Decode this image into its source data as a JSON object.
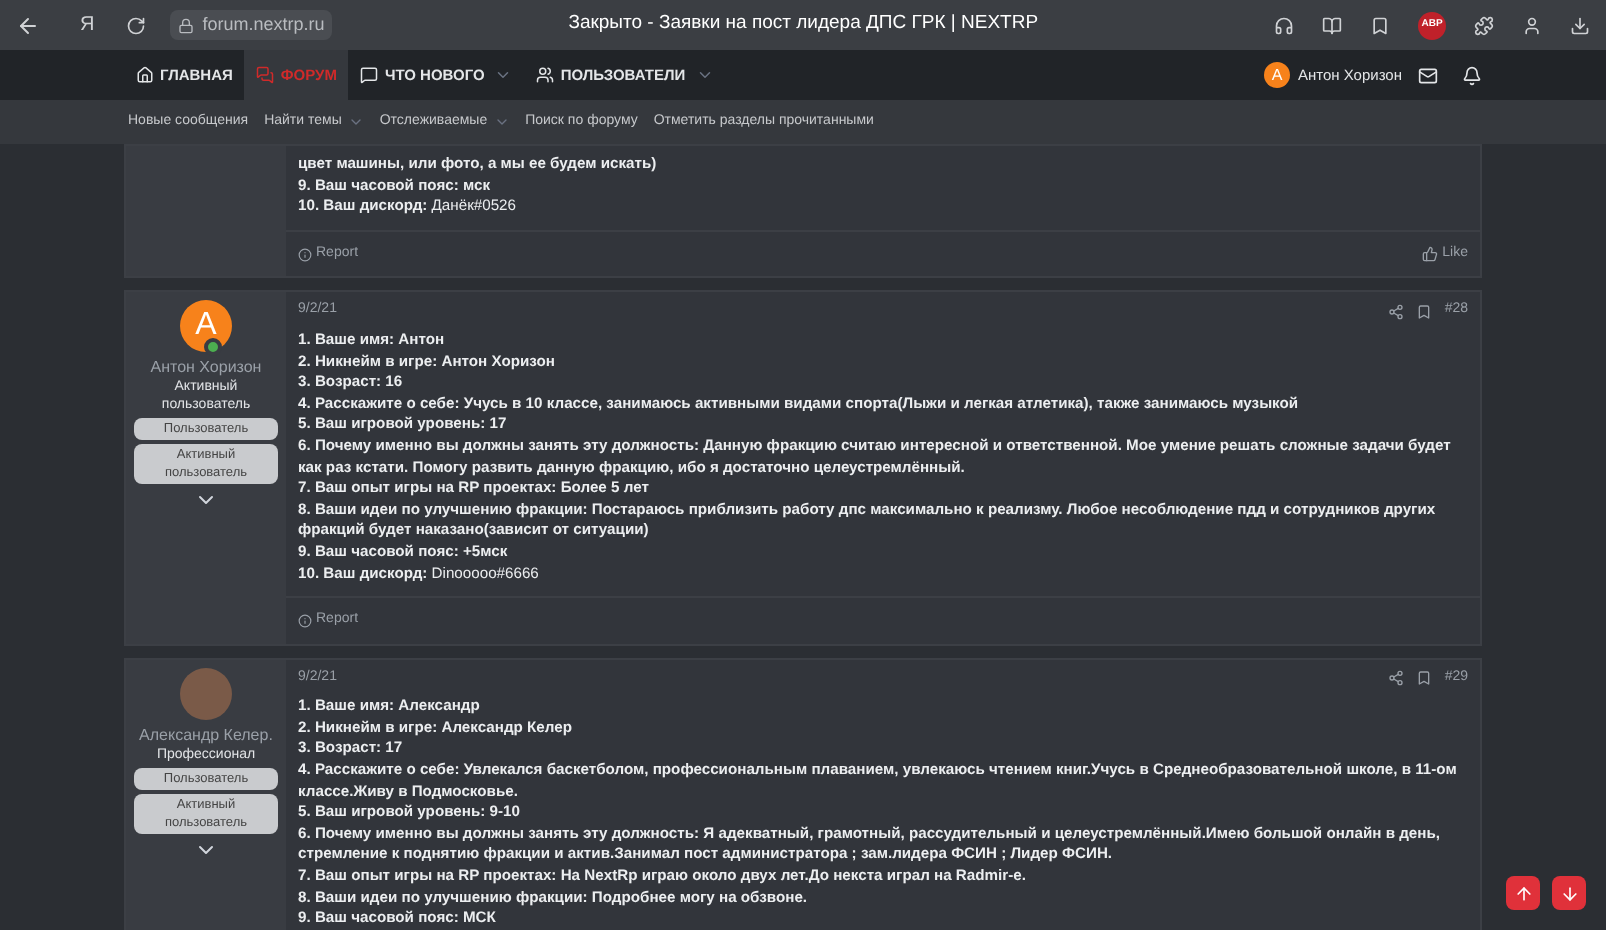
{
  "browser": {
    "url": "forum.nextrp.ru",
    "title": "Закрыто - Заявки на пост лидера ДПС ГРК | NEXTRP",
    "yandex": "Я",
    "adblock": "ABP"
  },
  "nav": {
    "items": [
      {
        "label": "ГЛАВНАЯ",
        "selected": false,
        "dropdown": false
      },
      {
        "label": "ФОРУМ",
        "selected": true,
        "dropdown": false
      },
      {
        "label": "ЧТО НОВОГО",
        "selected": false,
        "dropdown": true
      },
      {
        "label": "ПОЛЬЗОВАТЕЛИ",
        "selected": false,
        "dropdown": true
      }
    ],
    "user": {
      "initial": "A",
      "name": "Антон Хоризон"
    }
  },
  "subnav": [
    {
      "label": "Новые сообщения",
      "dropdown": false
    },
    {
      "label": "Найти темы",
      "dropdown": true
    },
    {
      "label": "Отслеживаемые",
      "dropdown": true
    },
    {
      "label": "Поиск по форуму",
      "dropdown": false
    },
    {
      "label": "Отметить разделы прочитанными",
      "dropdown": false
    }
  ],
  "posts": [
    {
      "partial": true,
      "lines": [
        {
          "kind": "bold",
          "text": "цвет машины, или фото, а мы ее будем искать)"
        },
        {
          "kind": "bold",
          "text": "9. Ваш часовой пояс: мск"
        },
        {
          "kind": "mixed",
          "text": "**10. Ваш дискорд:** Данёк#0526"
        }
      ],
      "report": "Report",
      "like": "Like"
    },
    {
      "partial": false,
      "avatar": {
        "kind": "letter",
        "initial": "A",
        "online": true
      },
      "author": "Антон Хоризон",
      "title": "Активный пользователь",
      "badges": [
        "Пользователь",
        "Активный пользователь"
      ],
      "date": "9/2/21",
      "number": "#28",
      "lines": [
        {
          "kind": "bold",
          "text": "1. Ваше имя: Антон"
        },
        {
          "kind": "bold",
          "text": "2. Никнейм в игре: Антон Хоризон"
        },
        {
          "kind": "bold",
          "text": "3. Возраст: 16"
        },
        {
          "kind": "bold",
          "text": "4. Расскажите о себе: Учусь в 10 классе, занимаюсь активными видами спорта(Лыжи и легкая атлетика), также занимаюсь музыкой"
        },
        {
          "kind": "bold",
          "text": "5. Ваш игровой уровень: 17"
        },
        {
          "kind": "bold",
          "text": "6. Почему именно вы должны занять эту должность: Данную фракцию считаю интересной и ответственной. Мое умение решать сложные задачи будет как раз кстати. Помогу развить данную фракцию, ибо я достаточно целеустремлённый."
        },
        {
          "kind": "bold",
          "text": "7. Ваш опыт игры на RP проектах: Более 5 лет"
        },
        {
          "kind": "bold",
          "text": "8. Ваши идеи по улучшению фракции: Постараюсь приблизить работу дпс максимально к реализму. Любое несоблюдение пдд и сотрудников других фракций будет наказано(зависит от ситуации)"
        },
        {
          "kind": "bold",
          "text": "9. Ваш часовой пояс: +5мск"
        },
        {
          "kind": "mixed",
          "text": "**10. Ваш дискорд:** Dinooooo#6666"
        }
      ],
      "report": "Report"
    },
    {
      "partial": false,
      "avatar": {
        "kind": "photo"
      },
      "author": "Александр Келер.",
      "title": "Профессионал",
      "badges": [
        "Пользователь",
        "Активный пользователь"
      ],
      "date": "9/2/21",
      "number": "#29",
      "lines": [
        {
          "kind": "bold",
          "text": "1. Ваше имя: Александр"
        },
        {
          "kind": "bold",
          "text": "2. Никнейм в игре: Александр Келер"
        },
        {
          "kind": "bold",
          "text": "3. Возраст: 17"
        },
        {
          "kind": "bold",
          "text": "4. Расскажите о себе: Увлекался баскетболом, профессиональным плаванием, увлекаюсь чтением книг.Учусь в Среднеобразовательной школе, в 11-ом классе.Живу в Подмосковье."
        },
        {
          "kind": "bold",
          "text": "5. Ваш игровой уровень: 9-10"
        },
        {
          "kind": "bold",
          "text": "6. Почему именно вы должны занять эту должность: Я адекватный, грамотный, рассудительный и целеустремлённый.Имею большой онлайн в день, стремление к поднятию фракции и актив.Занимал пост администратора ; зам.лидера ФСИН ; Лидер ФСИН."
        },
        {
          "kind": "bold",
          "text": "7. Ваш опыт игры на RP проектах: На NextRp играю около двух лет.До некста играл на Radmir-е."
        },
        {
          "kind": "bold",
          "text": "8. Ваши идеи по улучшению фракции: Подробнее могу на обзвоне."
        },
        {
          "kind": "bold",
          "text": "9. Ваш часовой пояс: МСК"
        }
      ]
    }
  ]
}
